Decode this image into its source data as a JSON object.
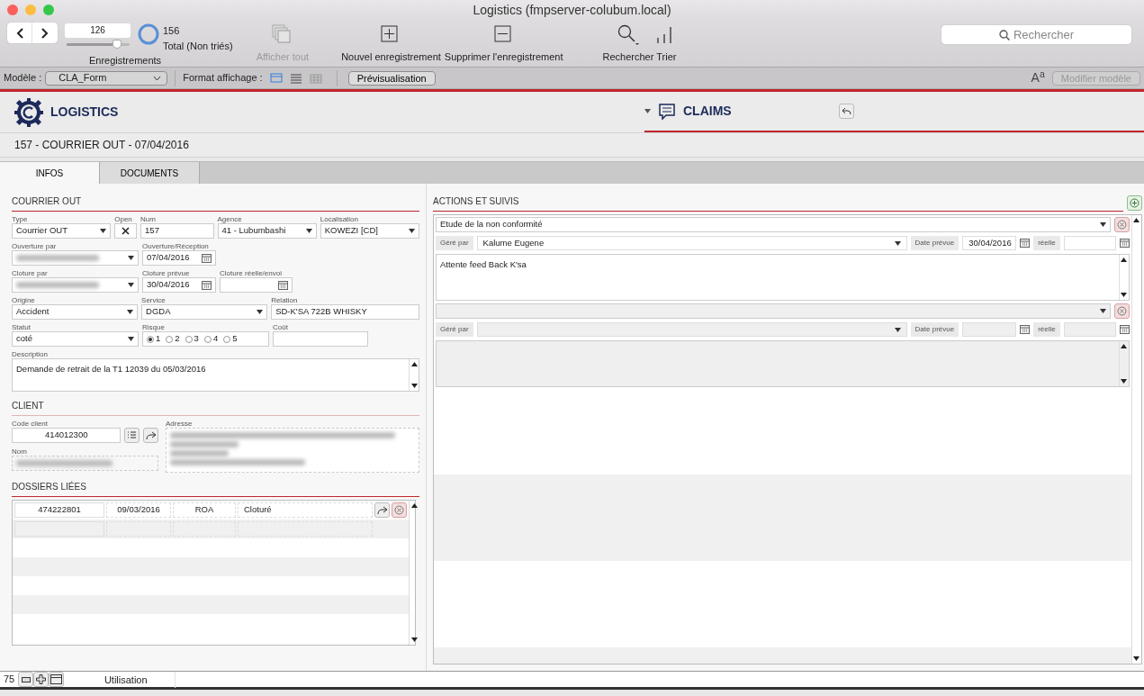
{
  "window": {
    "title": "Logistics (fmpserver-colubum.local)"
  },
  "toolbar": {
    "record_number": "126",
    "slider": {
      "level": 0.8
    },
    "found_count": "156",
    "found_label": "Total (Non triés)",
    "records_label": "Enregistrements",
    "buttons": [
      {
        "kind": "show-all",
        "label": "Afficher tout",
        "disabled": true
      },
      {
        "kind": "new",
        "label": "Nouvel enregistrement",
        "disabled": false
      },
      {
        "kind": "delete",
        "label": "Supprimer l'enregistrement",
        "disabled": false
      },
      {
        "kind": "find",
        "label": "Rechercher",
        "disabled": false
      },
      {
        "kind": "sort",
        "label": "Trier",
        "disabled": false
      }
    ],
    "search": {
      "placeholder": "Rechercher"
    }
  },
  "layout_bar": {
    "layout_label": "Modèle :",
    "layout_value": "CLA_Form",
    "format_label": "Format affichage :",
    "views": [
      {
        "kind": "form",
        "selected": true
      },
      {
        "kind": "list",
        "selected": false
      },
      {
        "kind": "table",
        "selected": false
      }
    ],
    "preview_button": "Prévisualisation",
    "text_format_button": "A$^{a}$",
    "edit_layout_button": {
      "label": "Modifier modèle",
      "disabled": true
    }
  },
  "header": {
    "brand": "LOGISTICS",
    "module": "CLAIMS",
    "record_title": "157 - COURRIER OUT - 07/04/2016"
  },
  "tabs": [
    {
      "label": "INFOS",
      "selected": true
    },
    {
      "label": "DOCUMENTS",
      "selected": false
    }
  ],
  "courrier": {
    "title": "COURRIER OUT",
    "fields": [
      {
        "kind": "dropdown",
        "label": "Type",
        "value": "Courrier OUT"
      },
      {
        "kind": "checkbox",
        "label": "Open",
        "checked": true
      },
      {
        "kind": "text",
        "label": "Num",
        "value": "157"
      },
      {
        "kind": "dropdown",
        "label": "Agence",
        "value": "41 - Lubumbashi"
      },
      {
        "kind": "dropdown",
        "label": "Localisation",
        "value": "KOWEZI [CD]"
      },
      {
        "kind": "dropdown",
        "label": "Ouverture par",
        "redacted": true
      },
      {
        "kind": "date",
        "label": "Ouverture/Réception",
        "value": "07/04/2016"
      },
      {
        "kind": "dropdown",
        "label": "Cloture par",
        "redacted": true
      },
      {
        "kind": "date",
        "label": "Cloture prévue",
        "value": "30/04/2016"
      },
      {
        "kind": "date",
        "label": "Cloture réelle/envoi"
      },
      {
        "kind": "dropdown",
        "label": "Origine",
        "value": "Accident"
      },
      {
        "kind": "dropdown",
        "label": "Service",
        "value": "DGDA"
      },
      {
        "kind": "text",
        "label": "Relation",
        "value": "SD-K'SA 722B WHISKY"
      },
      {
        "kind": "dropdown",
        "label": "Statut",
        "value": "coté"
      },
      {
        "kind": "radio",
        "label": "Risque",
        "options": [
          {
            "label": "1",
            "selected": true
          },
          {
            "label": "2",
            "selected": false
          },
          {
            "label": "3",
            "selected": false
          },
          {
            "label": "4",
            "selected": false
          },
          {
            "label": "5",
            "selected": false
          }
        ]
      },
      {
        "kind": "text",
        "label": "Coût"
      }
    ]
  },
  "description": {
    "label": "Description",
    "value": "Demande de retrait de la T1 12039 du 05/03/2016"
  },
  "client": {
    "title": "CLIENT",
    "code_label": "Code client",
    "code": "414012300",
    "address_label": "Adresse",
    "name_label": "Nom"
  },
  "dossiers": {
    "title": "DOSSIERS LIÉES",
    "rows": [
      {
        "cells": [
          "474222801",
          "09/03/2016",
          "ROA",
          "Cloturé"
        ]
      }
    ]
  },
  "actions": {
    "title": "ACTIONS ET SUIVIS",
    "items": [
      {
        "filled": true,
        "title": "Etude de la non conformité",
        "manager_label": "Géré par",
        "manager": "Kalume Eugene",
        "date_label": "Date prévue",
        "date": "30/04/2016",
        "real_label": "réelle",
        "note": "Attente feed Back K'sa"
      },
      {
        "filled": false,
        "manager_label": "Géré par",
        "date_label": "Date prévue",
        "real_label": "réelle"
      }
    ]
  },
  "status_bar": {
    "zoom": "75",
    "mode": "Utilisation"
  }
}
